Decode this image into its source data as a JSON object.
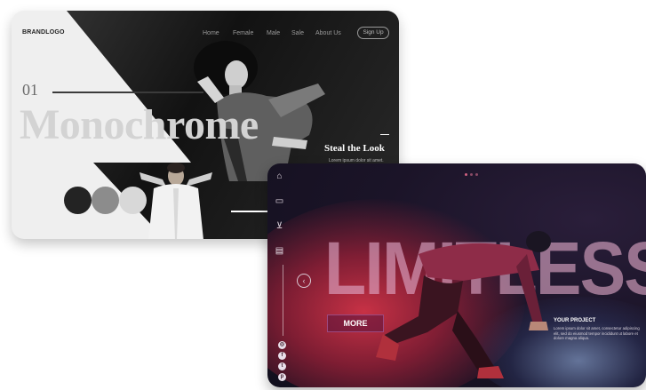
{
  "monochrome": {
    "logo": "BRANDLOGO",
    "nav": [
      "Home",
      "Female",
      "Male",
      "Sale",
      "About Us"
    ],
    "signup": "Sign Up",
    "number": "01",
    "title": "Monochrome",
    "tagline": "Steal the Look",
    "lorem": "Lorem ipsum dolor sit amet.",
    "swatches": [
      "#232323",
      "#8c8c8c",
      "#d8d8d8"
    ]
  },
  "limitless": {
    "title": "LIMITLESS",
    "more_label": "MORE",
    "project_heading": "YOUR PROJECT",
    "project_text": "Lorem ipsum dolor sit amet, consectetur adipiscing elit, sed do eiusmod tempor incididunt ut labore et dolore magna aliqua.",
    "sidebar_icons": [
      "home-icon",
      "image-icon",
      "cart-icon",
      "chat-icon"
    ],
    "social_icons": [
      "instagram-icon",
      "facebook-icon",
      "twitter-icon",
      "pinterest-icon"
    ],
    "accent": "#d63448"
  }
}
